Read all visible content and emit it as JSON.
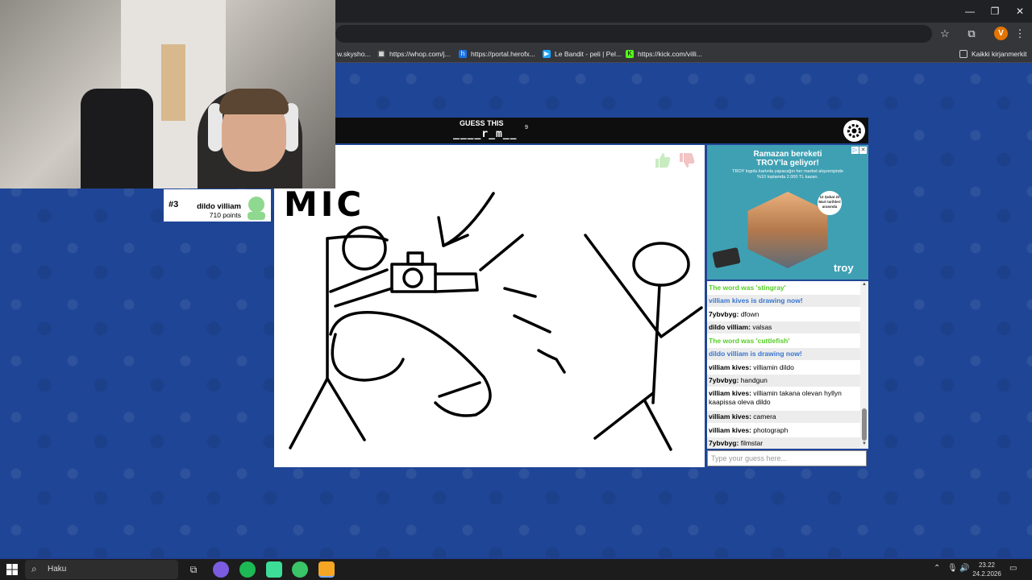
{
  "browser": {
    "profile_initial": "V",
    "bookmarks": [
      {
        "label": "w.skysho...",
        "color": "#6b6b6b"
      },
      {
        "label": "https://whop.com/j...",
        "color": "#444444"
      },
      {
        "label": "https://portal.herofx...",
        "color": "#1a73e8"
      },
      {
        "label": "Le Bandit - peli | Pel...",
        "color": "#1ea7fd"
      },
      {
        "label": "https://kick.com/villi...",
        "color": "#53fc18"
      }
    ],
    "all_bookmarks": "Kaikki kirjanmerkit"
  },
  "player": {
    "rank": "#3",
    "name": "dildo villiam",
    "points": "710 points"
  },
  "game": {
    "guess_label": "GUESS THIS",
    "word_hint": "____r_m__",
    "letter_count": "9",
    "canvas_text": "MIC"
  },
  "ad": {
    "title_line1": "Ramazan bereketi",
    "title_line2": "TROY’la geliyor!",
    "subtitle": "TROY logolu kartınla yapacağın her market alışverişinde %10 toplamda 2.000 TL kazan.",
    "badge": "12 Şubat 22 Mart tarihleri arasında",
    "brand": "troy"
  },
  "chat": {
    "messages": [
      {
        "type": "system-green",
        "text": "The word was 'stingray'"
      },
      {
        "type": "system-blue",
        "text": "villiam kives is drawing now!"
      },
      {
        "type": "user",
        "user": "7ybvbyg:",
        "text": "dfown"
      },
      {
        "type": "user",
        "user": "dildo villiam:",
        "text": "valsas"
      },
      {
        "type": "system-green",
        "text": "The word was 'cuttlefish'"
      },
      {
        "type": "system-blue",
        "text": "dildo villiam is drawing now!"
      },
      {
        "type": "user",
        "user": "villiam kives:",
        "text": "villiamin dildo"
      },
      {
        "type": "user",
        "user": "7ybvbyg:",
        "text": "handgun"
      },
      {
        "type": "user",
        "user": "villiam kives:",
        "text": "villiamin takana olevan hyllyn kaapissa oleva dildo"
      },
      {
        "type": "user",
        "user": "villiam kives:",
        "text": "camera"
      },
      {
        "type": "user",
        "user": "villiam kives:",
        "text": "photograph"
      },
      {
        "type": "user",
        "user": "7ybvbyg:",
        "text": "filmstar"
      }
    ],
    "input_placeholder": "Type your guess here..."
  },
  "taskbar": {
    "search_label": "Haku",
    "time": "23.22",
    "date": "24.2.2026"
  }
}
